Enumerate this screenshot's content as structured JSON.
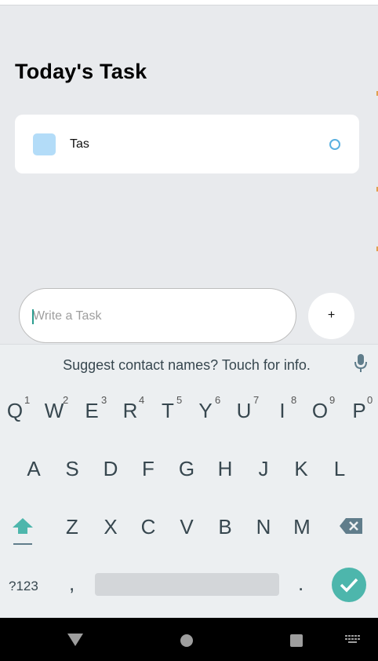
{
  "app": {
    "title": "Today's Task"
  },
  "tasks": [
    {
      "text": "Tas"
    }
  ],
  "input": {
    "placeholder": "Write a Task",
    "add_label": "+"
  },
  "keyboard": {
    "suggestion": "Suggest contact names? Touch for info.",
    "row1": [
      {
        "key": "Q",
        "hint": "1"
      },
      {
        "key": "W",
        "hint": "2"
      },
      {
        "key": "E",
        "hint": "3"
      },
      {
        "key": "R",
        "hint": "4"
      },
      {
        "key": "T",
        "hint": "5"
      },
      {
        "key": "Y",
        "hint": "6"
      },
      {
        "key": "U",
        "hint": "7"
      },
      {
        "key": "I",
        "hint": "8"
      },
      {
        "key": "O",
        "hint": "9"
      },
      {
        "key": "P",
        "hint": "0"
      }
    ],
    "row2": [
      "A",
      "S",
      "D",
      "F",
      "G",
      "H",
      "J",
      "K",
      "L"
    ],
    "row3": [
      "Z",
      "X",
      "C",
      "V",
      "B",
      "N",
      "M"
    ],
    "symbols_label": "?123",
    "comma": ",",
    "period": "."
  },
  "colors": {
    "background": "#e8eaed",
    "task_square": "#b3dcf8",
    "task_circle": "#5ab0e0",
    "accent": "#4db6ac",
    "keyboard_bg": "#eceff1"
  },
  "icons": {
    "mic": "microphone-icon",
    "shift": "shift-arrow-icon",
    "backspace": "backspace-icon",
    "enter": "checkmark-icon",
    "back": "nav-back-icon",
    "home": "nav-home-icon",
    "recents": "nav-recents-icon",
    "keyboard": "keyboard-switch-icon"
  }
}
